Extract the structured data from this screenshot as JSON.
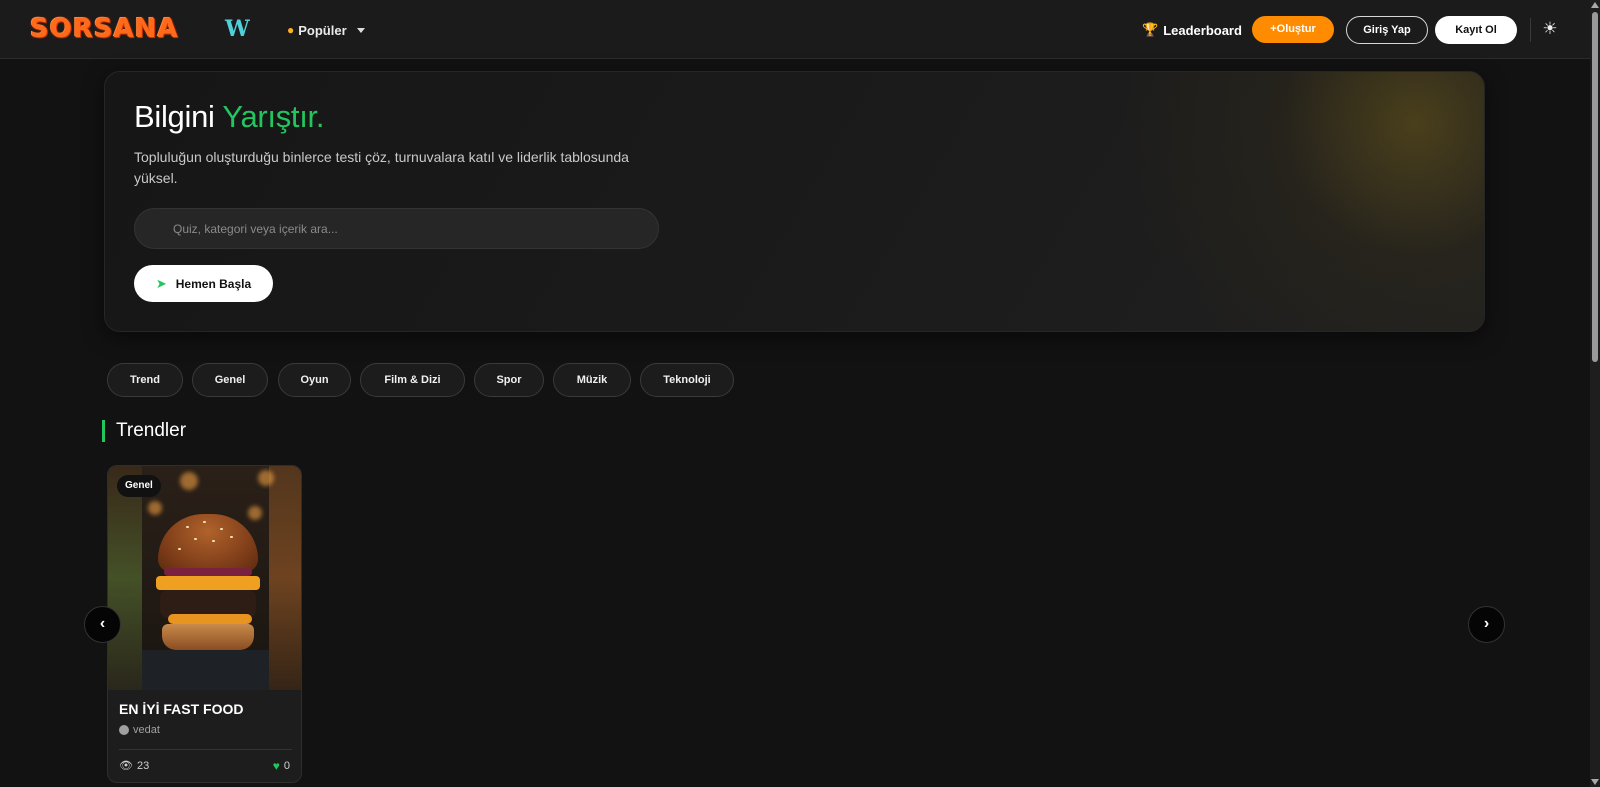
{
  "header": {
    "logo_text": "SORSANA",
    "w_logo": "W",
    "popular_label": "Popüler",
    "leaderboard_label": "Leaderboard",
    "create_label": "+Oluştur",
    "login_label": "Giriş Yap",
    "register_label": "Kayıt Ol",
    "icons": {
      "popular": "flame-icon",
      "leaderboard": "trophy-icon",
      "settings": "sun-icon"
    }
  },
  "hero": {
    "title_main": "Bilgini",
    "title_accent": "Yarıştır.",
    "subtitle": "Topluluğun oluşturduğu binlerce testi çöz, turnuvalara katıl ve liderlik tablosunda yüksel.",
    "search_placeholder": "Quiz, kategori veya içerik ara...",
    "start_label": "Hemen Başla"
  },
  "categories": [
    "Trend",
    "Genel",
    "Oyun",
    "Film & Dizi",
    "Spor",
    "Müzik",
    "Teknoloji"
  ],
  "section": {
    "title": "Trendler"
  },
  "cards": [
    {
      "tag": "Genel",
      "title": "EN İYİ FAST FOOD",
      "author": "vedat",
      "views": "23",
      "likes": "0"
    }
  ],
  "colors": {
    "accent_green": "#22c55e",
    "accent_orange": "#ff8c00",
    "background": "#121212"
  }
}
